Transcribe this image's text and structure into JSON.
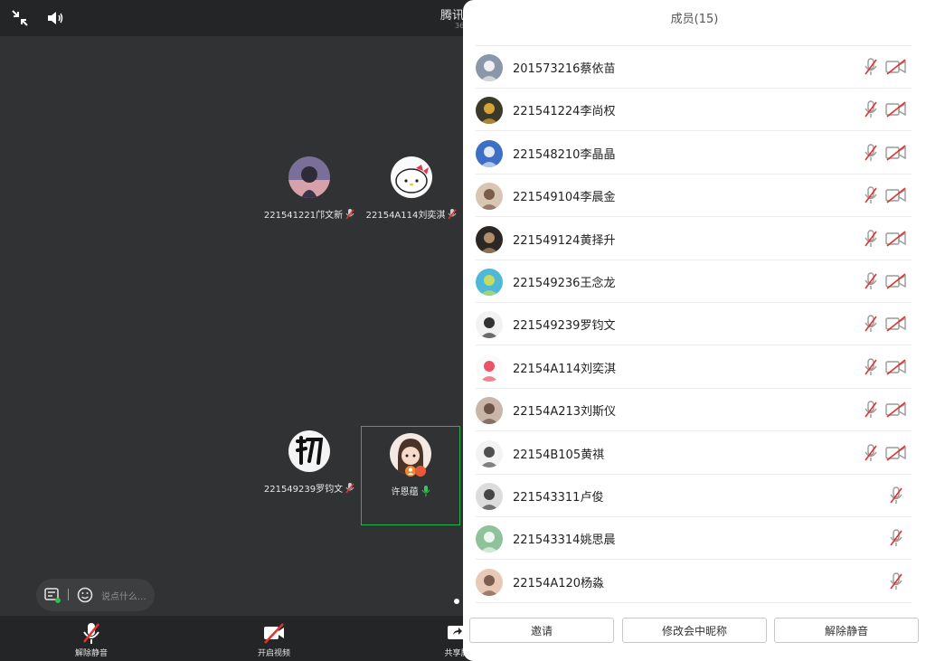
{
  "topbar": {
    "title": "腾讯",
    "subtitle": "36"
  },
  "tiles": [
    {
      "name": "221541221邝文新",
      "avatar": "anime-boy"
    },
    {
      "name": "22154A114刘奕淇",
      "avatar": "hello-kitty"
    },
    {
      "name": "221549239罗钧文",
      "avatar": "calligraphy-chu"
    },
    {
      "name": "许恩蕴",
      "avatar": "cartoon-girl"
    }
  ],
  "chat": {
    "placeholder": "说点什么..."
  },
  "bottombar": {
    "unmute_label": "解除静音",
    "start_video_label": "开启视频",
    "share_label": "共享屏"
  },
  "panel": {
    "title": "成员(15)",
    "members": [
      {
        "name": "201573216蔡依苗",
        "camera": true
      },
      {
        "name": "221541224李尚权",
        "camera": true
      },
      {
        "name": "221548210李晶晶",
        "camera": true
      },
      {
        "name": "221549104李晨金",
        "camera": true
      },
      {
        "name": "221549124黄择升",
        "camera": true
      },
      {
        "name": "221549236王念龙",
        "camera": true
      },
      {
        "name": "221549239罗钧文",
        "camera": true
      },
      {
        "name": "22154A114刘奕淇",
        "camera": true
      },
      {
        "name": "22154A213刘斯仪",
        "camera": true
      },
      {
        "name": "22154B105黄祺",
        "camera": true
      },
      {
        "name": "221543311卢俊",
        "camera": false
      },
      {
        "name": "221543314姚思晨",
        "camera": false
      },
      {
        "name": "22154A120杨淼",
        "camera": false
      }
    ],
    "buttons": {
      "invite": "邀请",
      "rename": "修改会中昵称",
      "unmute_all": "解除静音"
    }
  },
  "colors": {
    "active_border": "#26b34a",
    "mute_red": "#e0322e",
    "icon_gray": "#9a9a9a"
  }
}
